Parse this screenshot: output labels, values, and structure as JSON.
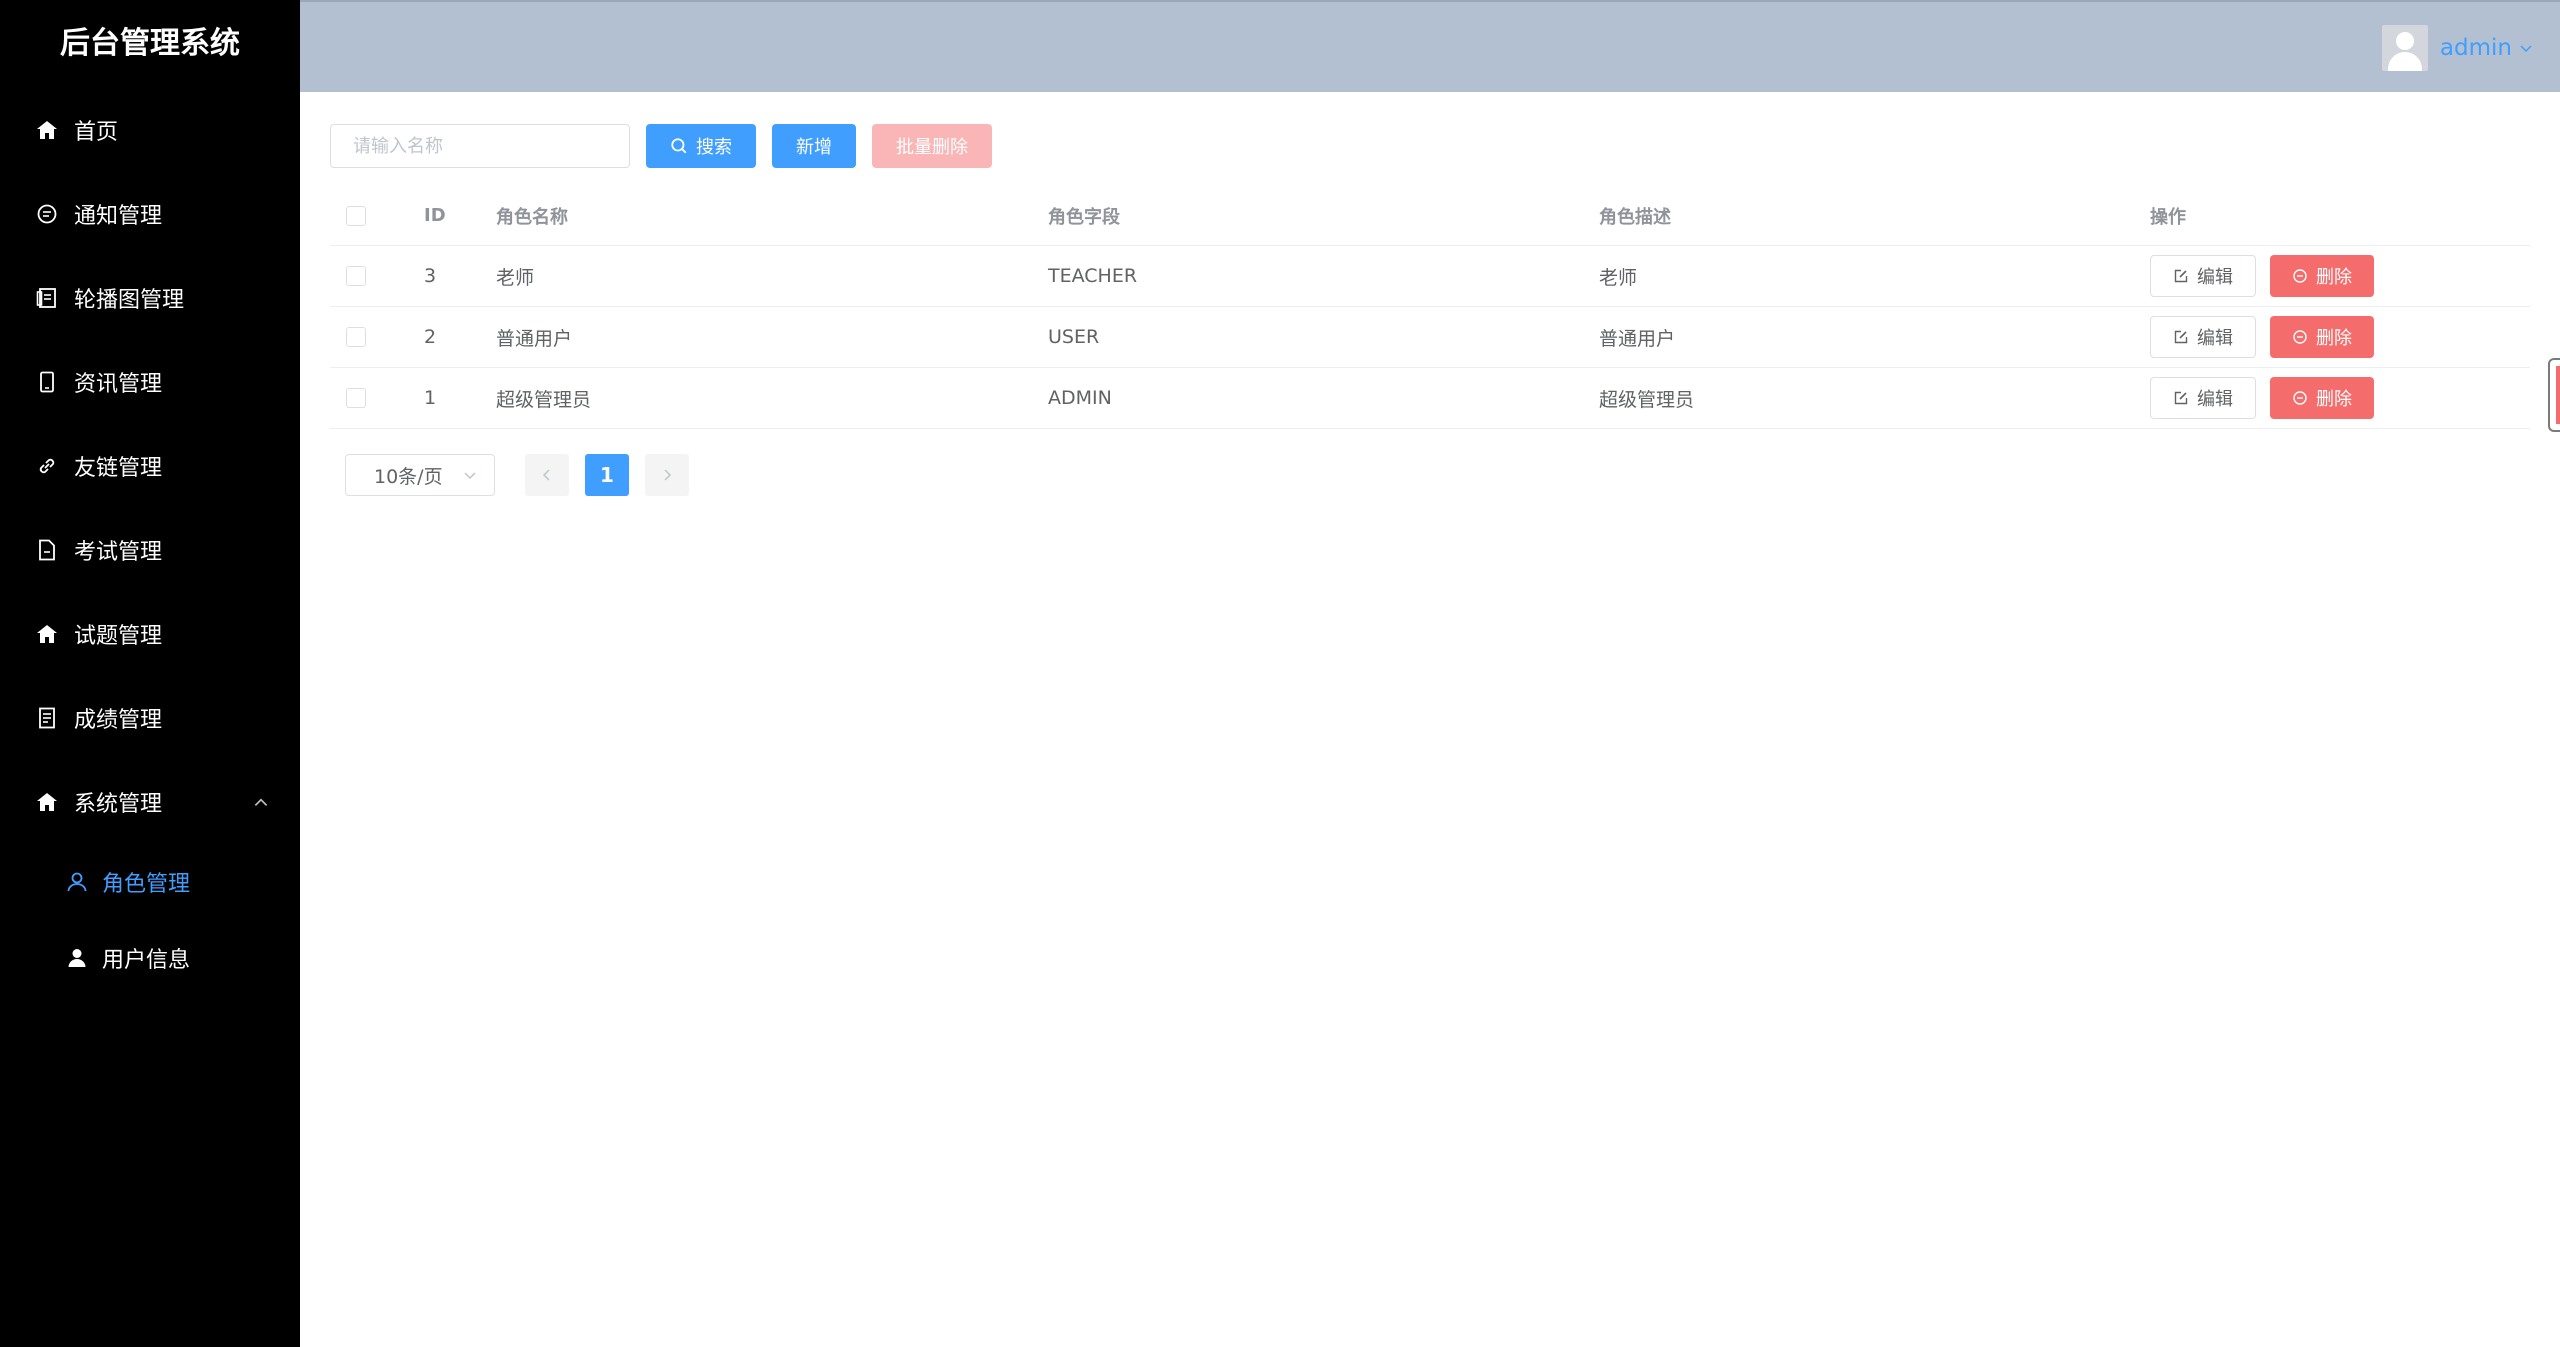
{
  "app": {
    "title": "后台管理系统"
  },
  "sidebar": {
    "items": [
      {
        "label": "首页",
        "icon": "home-icon"
      },
      {
        "label": "通知管理",
        "icon": "chat-icon"
      },
      {
        "label": "轮播图管理",
        "icon": "document-icon"
      },
      {
        "label": "资讯管理",
        "icon": "mobile-icon"
      },
      {
        "label": "友链管理",
        "icon": "link-icon"
      },
      {
        "label": "考试管理",
        "icon": "file-icon"
      },
      {
        "label": "试题管理",
        "icon": "home-icon"
      },
      {
        "label": "成绩管理",
        "icon": "list-icon"
      },
      {
        "label": "系统管理",
        "icon": "home-icon",
        "expanded": true
      }
    ],
    "submenu": [
      {
        "label": "角色管理",
        "icon": "user-outline-icon",
        "active": true
      },
      {
        "label": "用户信息",
        "icon": "user-solid-icon",
        "active": false
      }
    ]
  },
  "header": {
    "username": "admin"
  },
  "toolbar": {
    "search_placeholder": "请输入名称",
    "search_value": "",
    "search_label": "搜索",
    "add_label": "新增",
    "batch_delete_label": "批量删除"
  },
  "table": {
    "columns": [
      "ID",
      "角色名称",
      "角色字段",
      "角色描述",
      "操作"
    ],
    "rows": [
      {
        "id": "3",
        "name": "老师",
        "field": "TEACHER",
        "desc": "老师"
      },
      {
        "id": "2",
        "name": "普通用户",
        "field": "USER",
        "desc": "普通用户"
      },
      {
        "id": "1",
        "name": "超级管理员",
        "field": "ADMIN",
        "desc": "超级管理员"
      }
    ],
    "edit_label": "编辑",
    "delete_label": "删除"
  },
  "pagination": {
    "page_size": "10条/页",
    "current_page": "1"
  },
  "colors": {
    "primary": "#409eff",
    "danger": "#f56c6c",
    "danger_disabled": "#fab6b6",
    "header_bg": "#b3c0d1",
    "sidebar_bg": "#000000"
  }
}
